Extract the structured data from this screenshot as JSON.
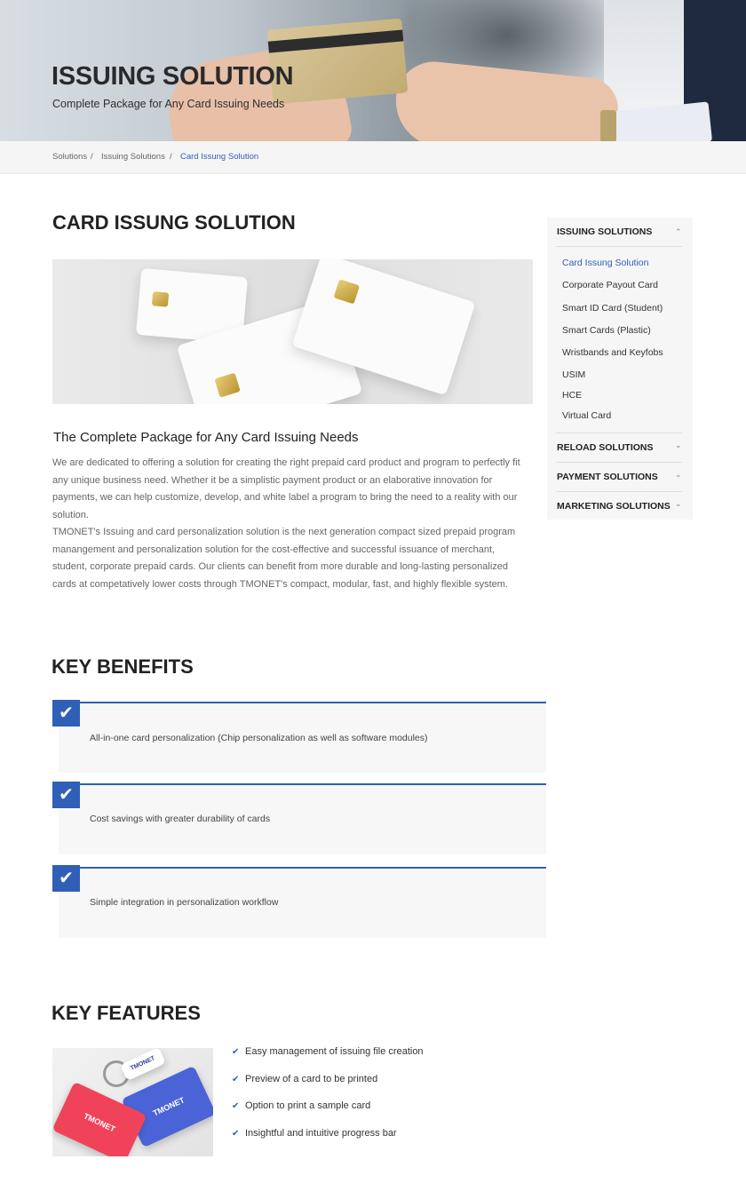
{
  "hero": {
    "title": "ISSUING SOLUTION",
    "subtitle": "Complete Package for  Any Card Issuing Needs"
  },
  "breadcrumb": {
    "items": [
      "Solutions",
      "Issuing Solutions",
      "Card Issung Solution"
    ],
    "separator": "/"
  },
  "page": {
    "title": "CARD ISSUNG SOLUTION"
  },
  "intro": {
    "heading": "The Complete Package for Any Card Issuing Needs",
    "paragraph1": "We are dedicated to offering a solution for creating the right prepaid card product and program to perfectly fit any unique business need. Whether it be a simplistic payment product or an elaborative innovation for payments, we can help customize, develop, and white label a program to bring the need to a reality with our solution.",
    "paragraph2": "TMONET's Issuing and card personalization solution is the next generation compact sized prepaid program manangement and personalization solution for the cost-effective and successful issuance of merchant, student, corporate prepaid cards. Our clients can benefit from more durable and long-lasting personalized cards at competatively lower costs through TMONET's compact, modular, fast, and highly flexible system."
  },
  "sidebar": {
    "sections": [
      {
        "label": "ISSUING SOLUTIONS",
        "arrow": "⌃",
        "items": [
          {
            "label": "Card Issung Solution",
            "active": true
          },
          {
            "label": "Corporate Payout Card"
          },
          {
            "label": "Smart ID Card (Student)"
          },
          {
            "label": "Smart Cards (Plastic)"
          },
          {
            "label": "Wristbands and Keyfobs"
          },
          {
            "label": "USIM"
          },
          {
            "label": "HCE"
          },
          {
            "label": "Virtual Card"
          }
        ]
      },
      {
        "label": "RELOAD SOLUTIONS",
        "arrow": "⌄"
      },
      {
        "label": "PAYMENT SOLUTIONS",
        "arrow": "⌄"
      },
      {
        "label": "MARKETING SOLUTIONS",
        "arrow": "⌄"
      }
    ]
  },
  "benefits": {
    "title": "KEY BENEFITS",
    "check_glyph": "✔",
    "items": [
      "All-in-one card personalization (Chip personalization as well as software modules)",
      "Cost savings with greater durability of cards",
      "Simple integration in personalization workflow"
    ]
  },
  "features": {
    "title": "KEY FEATURES",
    "tick_glyph": "✔",
    "image_brand": "TMONET",
    "items": [
      "Easy management of issuing file creation",
      "Preview of a card to be printed",
      "Option to print a sample card",
      "Insightful and intuitive progress bar"
    ]
  },
  "colors": {
    "accent": "#2f5fb6",
    "text_dark": "#222222",
    "text_body": "#666666",
    "panel_bg": "#f6f6f6",
    "red_card": "#f0435a",
    "blue_card": "#4a63d6"
  },
  "icons": {
    "check": "check-icon",
    "chevron_up": "chevron-up-icon",
    "chevron_down": "chevron-down-icon"
  }
}
